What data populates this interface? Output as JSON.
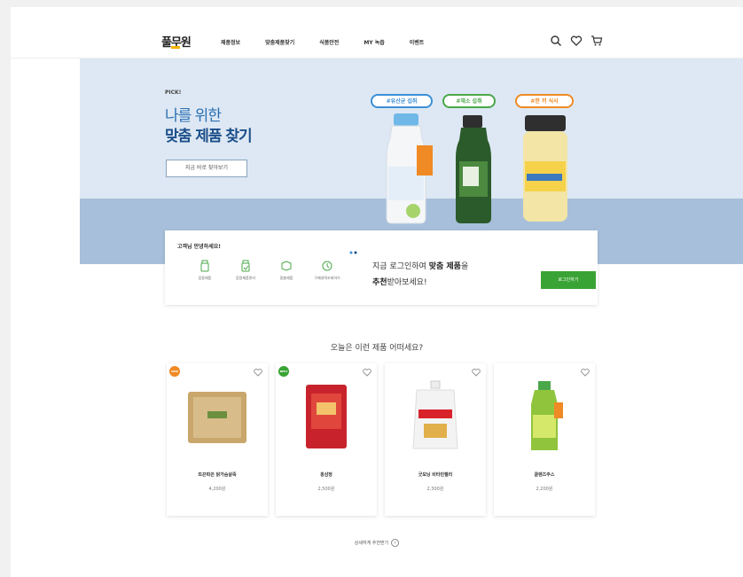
{
  "header": {
    "util_left": "",
    "util_right": "",
    "logo": "풀무원",
    "menu": [
      "제품정보",
      "맞춤제품찾기",
      "식품안전",
      "MY 녹즙",
      "이벤트"
    ],
    "icons": [
      "search-icon",
      "heart-icon",
      "cart-icon"
    ]
  },
  "hero": {
    "pick": "PICK!",
    "title_line1": "나를 위한",
    "title_line2": "맞춤 제품 찾기",
    "button_label": "지금 바로 찾아보기",
    "tags": [
      {
        "label": "#유산균 섭취",
        "color": "#3b8fd6"
      },
      {
        "label": "#채소 섭취",
        "color": "#4aa74a"
      },
      {
        "label": "#한 끼 식사",
        "color": "#f08a24"
      }
    ]
  },
  "login_card": {
    "greeting": "고객님 안녕하세요!",
    "quick_links": [
      {
        "label": "음용제품",
        "icon": "bottle-icon"
      },
      {
        "label": "음용제품관리",
        "icon": "bottle-check-icon"
      },
      {
        "label": "맞춤제품",
        "icon": "box-icon"
      },
      {
        "label": "구매내역조회하기",
        "icon": "clock-icon"
      }
    ],
    "message_line1_pre": "지금 로그인하여 ",
    "message_line1_bold": "맞춤 제품",
    "message_line1_post": "을",
    "message_line2_bold": "추천",
    "message_line2_post": "받아보세요!",
    "login_button": "로그인하기"
  },
  "recommend": {
    "title": "오늘은 이런 제품 어떠세요?",
    "products": [
      {
        "name": "뜨끈따끈 닭가슴살죽",
        "price": "4,200원",
        "badge": "NEW",
        "badge_color": "#f08a24",
        "image": "pouch-beige"
      },
      {
        "name": "홍삼정",
        "price": "2,500원",
        "badge": "BEST",
        "badge_color": "#3aa335",
        "image": "pouch-red"
      },
      {
        "name": "굿모닝 비타민젤리",
        "price": "2,300원",
        "badge": "",
        "badge_color": "",
        "image": "jelly-pouch"
      },
      {
        "name": "클렌즈주스",
        "price": "2,200원",
        "badge": "",
        "badge_color": "",
        "image": "bottle-green"
      }
    ],
    "more_label": "상세하게 추천받기"
  }
}
